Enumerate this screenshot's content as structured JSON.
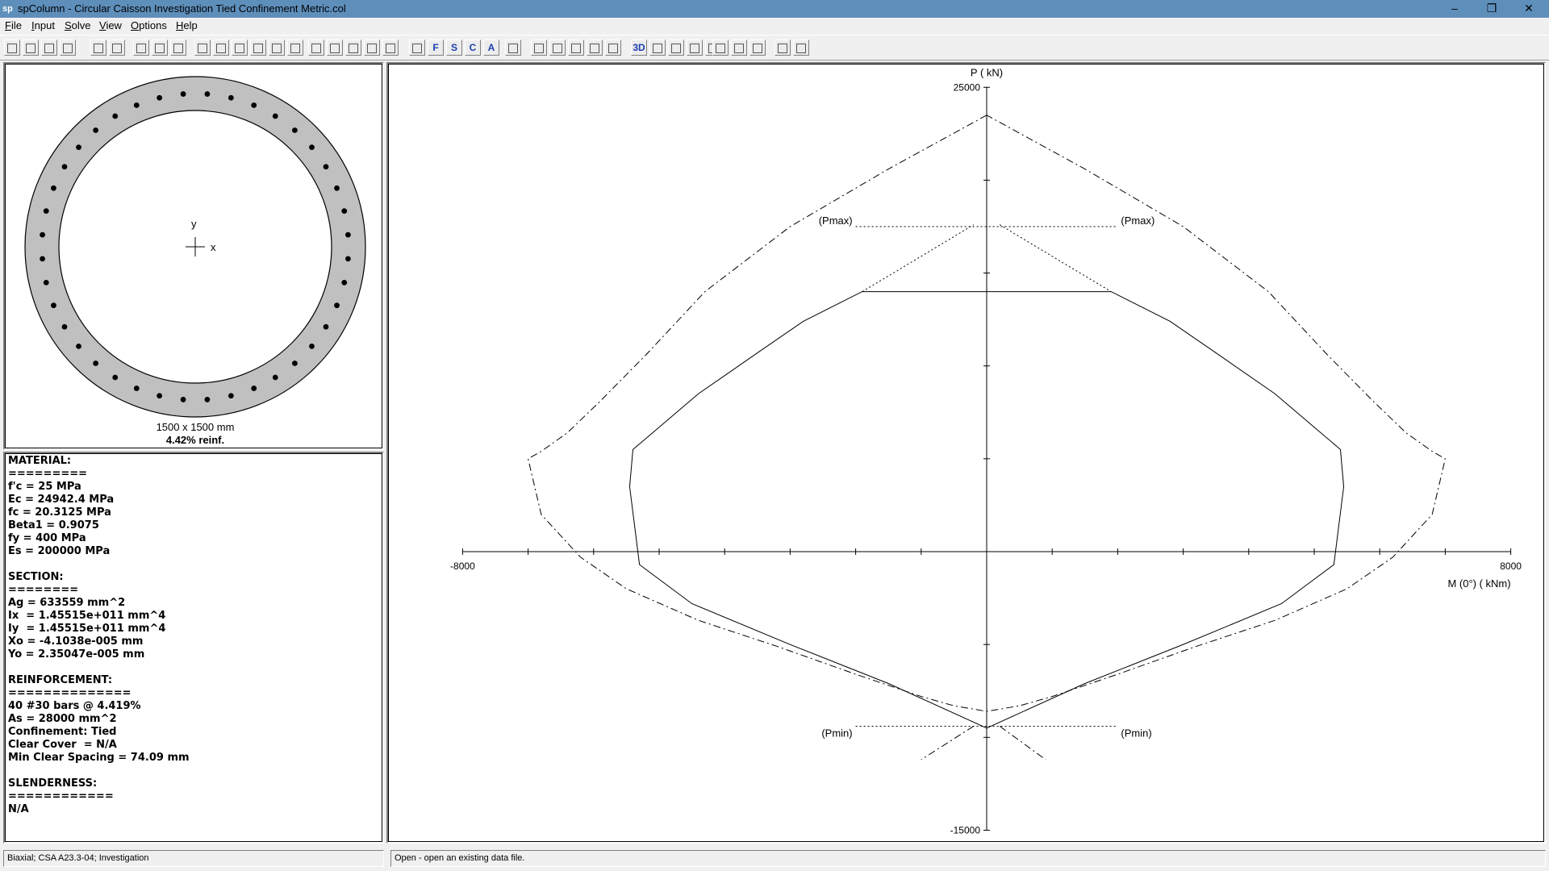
{
  "app": {
    "logo": "sp",
    "title": "spColumn - Circular Caisson Investigation Tied Confinement Metric.col"
  },
  "window_controls": {
    "minimize": "–",
    "restore": "❐",
    "close": "✕"
  },
  "menu": [
    {
      "label": "File",
      "mnemonic": "F",
      "rest": "ile"
    },
    {
      "label": "Input",
      "mnemonic": "I",
      "rest": "nput"
    },
    {
      "label": "Solve",
      "mnemonic": "S",
      "rest": "olve"
    },
    {
      "label": "View",
      "mnemonic": "V",
      "rest": "iew"
    },
    {
      "label": "Options",
      "mnemonic": "O",
      "rest": "ptions"
    },
    {
      "label": "Help",
      "mnemonic": "H",
      "rest": "elp"
    }
  ],
  "toolbar_icons": [
    "open-icon",
    "save-icon",
    "print-icon",
    "print-setup-icon",
    "general-info-icon",
    "material-props-icon",
    "rect-section-icon",
    "circular-section-icon",
    "irregular-section-icon",
    "reinf-all-sides-icon",
    "reinf-two-sides-icon",
    "reinf-four-sides-icon",
    "reinf-sides-different-icon",
    "reinf-irregular-icon",
    "reinf-spiral-icon",
    "slenderness-icon",
    "loads-factored-icon",
    "loads-service-icon",
    "loads-control-icon",
    "loads-axial-icon",
    "loads-table-icon",
    "f-font-icon",
    "s-font-icon",
    "c-font-icon",
    "a-font-icon",
    "sort-icon",
    "grid-icon",
    "zoom-icon",
    "rotate-x-icon",
    "rotate-y-icon",
    "rotate-z-icon",
    "3d-view-icon",
    "pan-up-icon",
    "pan-down-icon",
    "zoom-in-icon",
    "zoom-out-icon",
    "sliding-load-icon",
    "factored-18-icon",
    "phi-icon",
    "sp-icon",
    "report-icon",
    "report-table-icon"
  ],
  "section": {
    "dimensions": "1500 x 1500 mm",
    "reinforcement_ratio": "4.42% reinf.",
    "axis_y": "y",
    "axis_x": "x",
    "bar_count": 40
  },
  "properties": {
    "lines": [
      "MATERIAL:",
      "=========",
      "f'c = 25 MPa",
      "Ec = 24942.4 MPa",
      "fc = 20.3125 MPa",
      "Beta1 = 0.9075",
      "fy = 400 MPa",
      "Es = 200000 MPa",
      "",
      "SECTION:",
      "========",
      "Ag = 633559 mm^2",
      "Ix  = 1.45515e+011 mm^4",
      "Iy  = 1.45515e+011 mm^4",
      "Xo = -4.1038e-005 mm",
      "Yo = 2.35047e-005 mm",
      "",
      "REINFORCEMENT:",
      "==============",
      "40 #30 bars @ 4.419%",
      "As = 28000 mm^2",
      "Confinement: Tied",
      "Clear Cover  = N/A",
      "Min Clear Spacing = 74.09 mm",
      "",
      "SLENDERNESS:",
      "============",
      "N/A"
    ]
  },
  "chart_data": {
    "type": "line",
    "title": "",
    "xlabel": "M (0°) ( kNm)",
    "ylabel": "P ( kN)",
    "xlim": [
      -8000,
      8000
    ],
    "ylim": [
      -15000,
      25000
    ],
    "x_tick_labels": [
      "-8000",
      "8000"
    ],
    "y_tick_labels": [
      "25000",
      "-15000"
    ],
    "x_tick_step": 1000,
    "y_tick_step": 5000,
    "annotations": {
      "pmax_left": "(Pmax)",
      "pmax_right": "(Pmax)",
      "pmin_left": "(Pmin)",
      "pmin_right": "(Pmin)"
    },
    "series": [
      {
        "style": "dash-dot",
        "x": [
          0,
          -1500,
          -3000,
          -4300,
          -5200,
          -5900,
          -6400,
          -6800,
          -7000,
          -6800,
          -6200,
          -5500,
          -4400,
          -3200,
          -2000,
          -1000,
          -500,
          0,
          500,
          1000,
          2000,
          3200,
          4400,
          5500,
          6200,
          6800,
          7000,
          6800,
          6400,
          5900,
          5200,
          4300,
          3000,
          1500,
          0
        ],
        "y": [
          23500,
          20600,
          17500,
          14000,
          10600,
          8100,
          6400,
          5400,
          5000,
          2000,
          -300,
          -2000,
          -3700,
          -5100,
          -6600,
          -7800,
          -8300,
          -8600,
          -8300,
          -7800,
          -6600,
          -5100,
          -3700,
          -2000,
          -300,
          2000,
          5000,
          5400,
          6400,
          8100,
          10600,
          14000,
          17500,
          20600,
          23500
        ]
      },
      {
        "style": "solid",
        "x": [
          0,
          -1300,
          -1900,
          -2800,
          -3500,
          -4400,
          -5000,
          -5400,
          -5450,
          -5300,
          -4500,
          -3000,
          -1500,
          0,
          1500,
          3000,
          4500,
          5300,
          5450,
          5400,
          5000,
          4400,
          3500,
          2800,
          1900,
          1300,
          0
        ],
        "y": [
          14000,
          14000,
          14000,
          12400,
          10700,
          8500,
          6700,
          5500,
          3500,
          -700,
          -2800,
          -5000,
          -7100,
          -9500,
          -7100,
          -5000,
          -2800,
          -700,
          3500,
          5500,
          6700,
          8500,
          10700,
          12400,
          14000,
          14000,
          14000
        ]
      },
      {
        "style": "dotted",
        "x": [
          -1900,
          -1000,
          -200
        ],
        "y": [
          14000,
          15900,
          17600
        ]
      },
      {
        "style": "dotted",
        "x": [
          200,
          1000,
          1900
        ],
        "y": [
          17600,
          15900,
          14000
        ]
      },
      {
        "style": "dotted",
        "x": [
          -2000,
          2000
        ],
        "y": [
          17500,
          17500
        ]
      },
      {
        "style": "dotted",
        "x": [
          -2000,
          2000
        ],
        "y": [
          -9400,
          -9400
        ]
      },
      {
        "style": "dash-dot",
        "x": [
          -200,
          -1000
        ],
        "y": [
          -9400,
          -11200
        ]
      },
      {
        "style": "dash-dot",
        "x": [
          200,
          900
        ],
        "y": [
          -9400,
          -11200
        ]
      }
    ]
  },
  "status": {
    "left": "Biaxial; CSA A23.3-04; Investigation",
    "right": "Open - open an existing data file."
  }
}
